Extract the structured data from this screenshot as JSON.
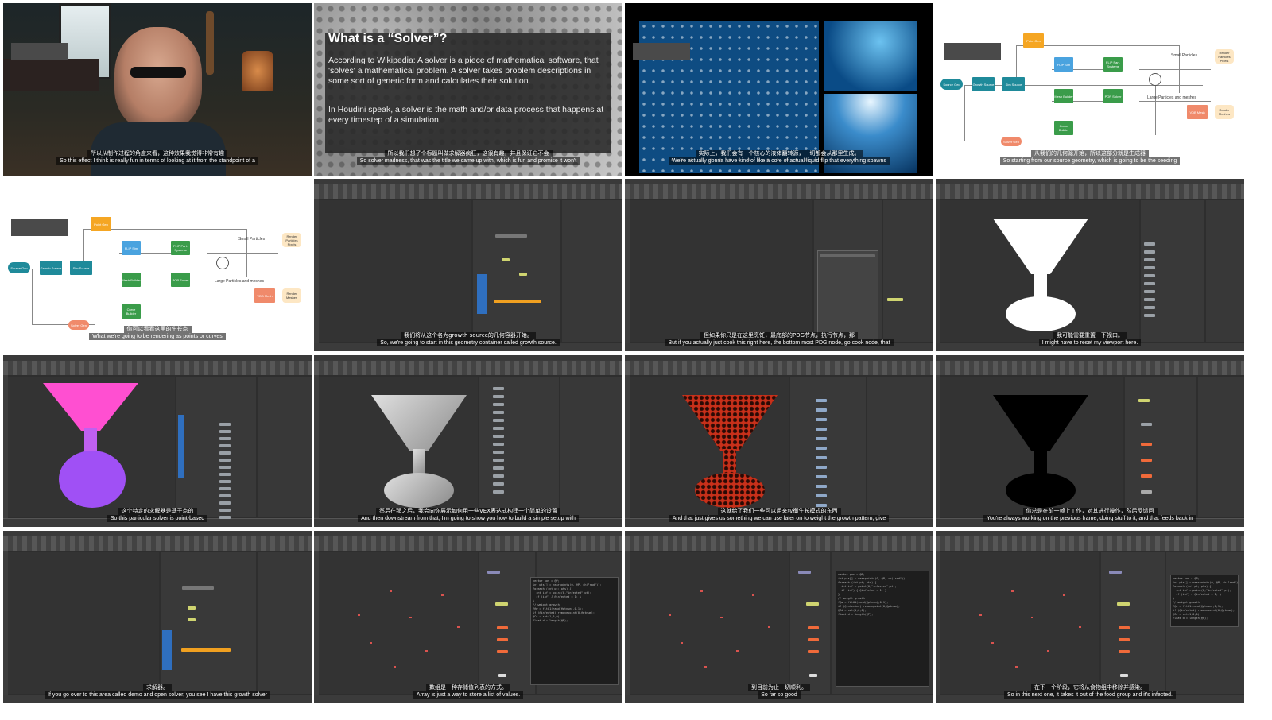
{
  "tiles": [
    {
      "id": "webcam",
      "zh": "所以从制作过程的角度来看，这种效果我觉得非常有趣",
      "en": "So this effect I think is really fun in terms of looking at it from the standpoint of a"
    },
    {
      "id": "slide-solver",
      "title": "What is a “Solver”?",
      "para1": "According to Wikipedia: A solver is a piece of mathematical software, that 'solves' a mathematical problem. A solver takes problem descriptions in some sort of generic form and calculates their solution.",
      "para2": "In Houdini speak, a solver is the math and/or data process that happens at every timestep of a simulation",
      "zh": "所以我们想了个标题叫做求解器疯狂，这很有趣，并且保证它不会",
      "en": "So solver madness, that was the title we came up with, which is fun and promise it won't"
    },
    {
      "id": "bubbles",
      "zh": "实际上，我们会有一个核心的液体翻转源，一切都会从那里生成。",
      "en": "We're actually gonna have kind of like a core of actual liquid flip that everything spawns"
    },
    {
      "id": "flowchart-1",
      "zh": "从我们的几何源开始，所以这部分就是生成器",
      "en": "So starting from our source geometry, which is going to be the seeding"
    },
    {
      "id": "flowchart-2",
      "zh": "你可以看看这里的生长点",
      "en": "What we're going to be rendering as points or curves"
    },
    {
      "id": "houdini-a",
      "zh": "我们将从这个名为growth source的几何容器开始。",
      "en": "So, we're going to start in this geometry container called growth source."
    },
    {
      "id": "houdini-b",
      "zh": "但如果你只是在这里烹饪，最底部的PDG节点，执行节点，那",
      "en": "But if you actually just cook this right here, the bottom most PDG node, go cook node, that"
    },
    {
      "id": "houdini-c",
      "zh": "我可能需要重置一下视口。",
      "en": "I might have to reset my viewport here."
    },
    {
      "id": "houdini-d",
      "zh": "这个特定的求解器是基于点的",
      "en": "So this particular solver is point-based"
    },
    {
      "id": "houdini-e",
      "zh": "然后在那之后，我会向你展示如何用一些VEX表达式构建一个简单的设置",
      "en": "And then downstream from that, I'm going to show you how to build a simple setup with"
    },
    {
      "id": "houdini-f",
      "zh": "这就给了我们一些可以用来权衡生长模式的东西",
      "en": "And that just gives us something we can use later on to weight the growth pattern, give"
    },
    {
      "id": "houdini-g",
      "zh": "你总是在前一帧上工作，对其进行操作，然后反馈回",
      "en": "You're always working on the previous frame, doing stuff to it, and that feeds back in"
    },
    {
      "id": "houdini-h",
      "zh": "求解器。",
      "en": "If you go over to this area called demo and open solver, you see I have this growth solver"
    },
    {
      "id": "houdini-i",
      "zh": "数组是一种存储值列表的方式。",
      "en": "Array is just a way to store a list of values."
    },
    {
      "id": "houdini-j",
      "zh": "到目前为止一切顺利。",
      "en": "So far so good"
    },
    {
      "id": "houdini-k",
      "zh": "在下一个阶段，它将从食物组中移除并感染。",
      "en": "So in this next one, it takes it out of the food group and it's infected."
    }
  ],
  "flowchart": {
    "point_gen": "Point Gen",
    "seed": "Source Geo",
    "growth_source": "Growth Source",
    "sim_source": "Sim Source",
    "flip_sim": "FLIP Sim",
    "flip_particles": "FLIP Part. Systems",
    "pop_sim": "POP Solver",
    "mesh_builder": "Mesh Builder",
    "vdb": "Vol. Builder",
    "curve_builder": "Curve Builder",
    "mesh_gen": "VDB Mesh",
    "solver_box": "Solver Gen",
    "render_particles": "Render Particles Pixels",
    "render_meshes": "Render Meshes",
    "small_particles": "Small Particles",
    "large_particles": "Large Particles and meshes",
    "points": "Points",
    "labels": [
      "attribs",
      "Particles",
      "Volume",
      "SDF",
      "Points",
      "Meshes",
      "Feedback"
    ]
  },
  "colors": {
    "teal": "#1f8a9a",
    "orange": "#f5a623",
    "blue": "#4aa3df",
    "green": "#3a9c4a",
    "red": "#e8614d",
    "salmon": "#f08a6b",
    "cream": "#fde7c4"
  }
}
